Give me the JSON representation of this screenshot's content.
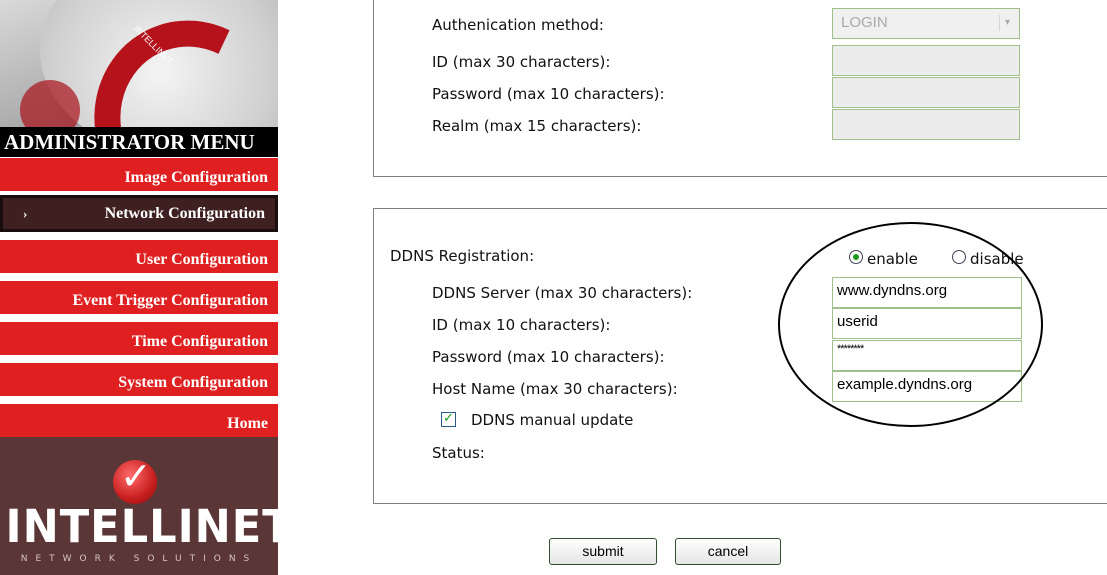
{
  "sidebar": {
    "header_brand": "INTELLINET",
    "title": "ADMINISTRATOR MENU",
    "items": [
      {
        "label": "Image Configuration"
      },
      {
        "label": "Network Configuration",
        "active": true,
        "arrow": "›"
      },
      {
        "label": "User Configuration"
      },
      {
        "label": "Event Trigger Configuration"
      },
      {
        "label": "Time Configuration"
      },
      {
        "label": "System Configuration"
      },
      {
        "label": "Home"
      }
    ],
    "logo": {
      "name": "INTELLINET",
      "tagline": "NETWORK SOLUTIONS"
    }
  },
  "auth": {
    "method_label": "Authenication method:",
    "method_value": "LOGIN",
    "id_label": "ID (max 30 characters):",
    "id_value": "",
    "password_label": "Password (max 10 characters):",
    "password_value": "",
    "realm_label": "Realm (max 15 characters):",
    "realm_value": ""
  },
  "ddns": {
    "registration_label": "DDNS Registration:",
    "enable_label": "enable",
    "disable_label": "disable",
    "registration_value": "enable",
    "server_label": "DDNS Server (max 30 characters):",
    "server_value": "www.dyndns.org",
    "id_label": "ID (max 10 characters):",
    "id_value": "userid",
    "password_label": "Password (max 10 characters):",
    "password_value": "********",
    "host_label": "Host Name (max 30 characters):",
    "host_value": "example.dyndns.org",
    "manual_update_label": "DDNS manual update",
    "manual_update_checked": true,
    "status_label": "Status:"
  },
  "buttons": {
    "submit": "submit",
    "cancel": "cancel"
  },
  "colors": {
    "menu_red": "#e02020",
    "menu_active": "#3f2020",
    "logo_bg": "#5a3636",
    "field_border": "#9fbf8b"
  }
}
